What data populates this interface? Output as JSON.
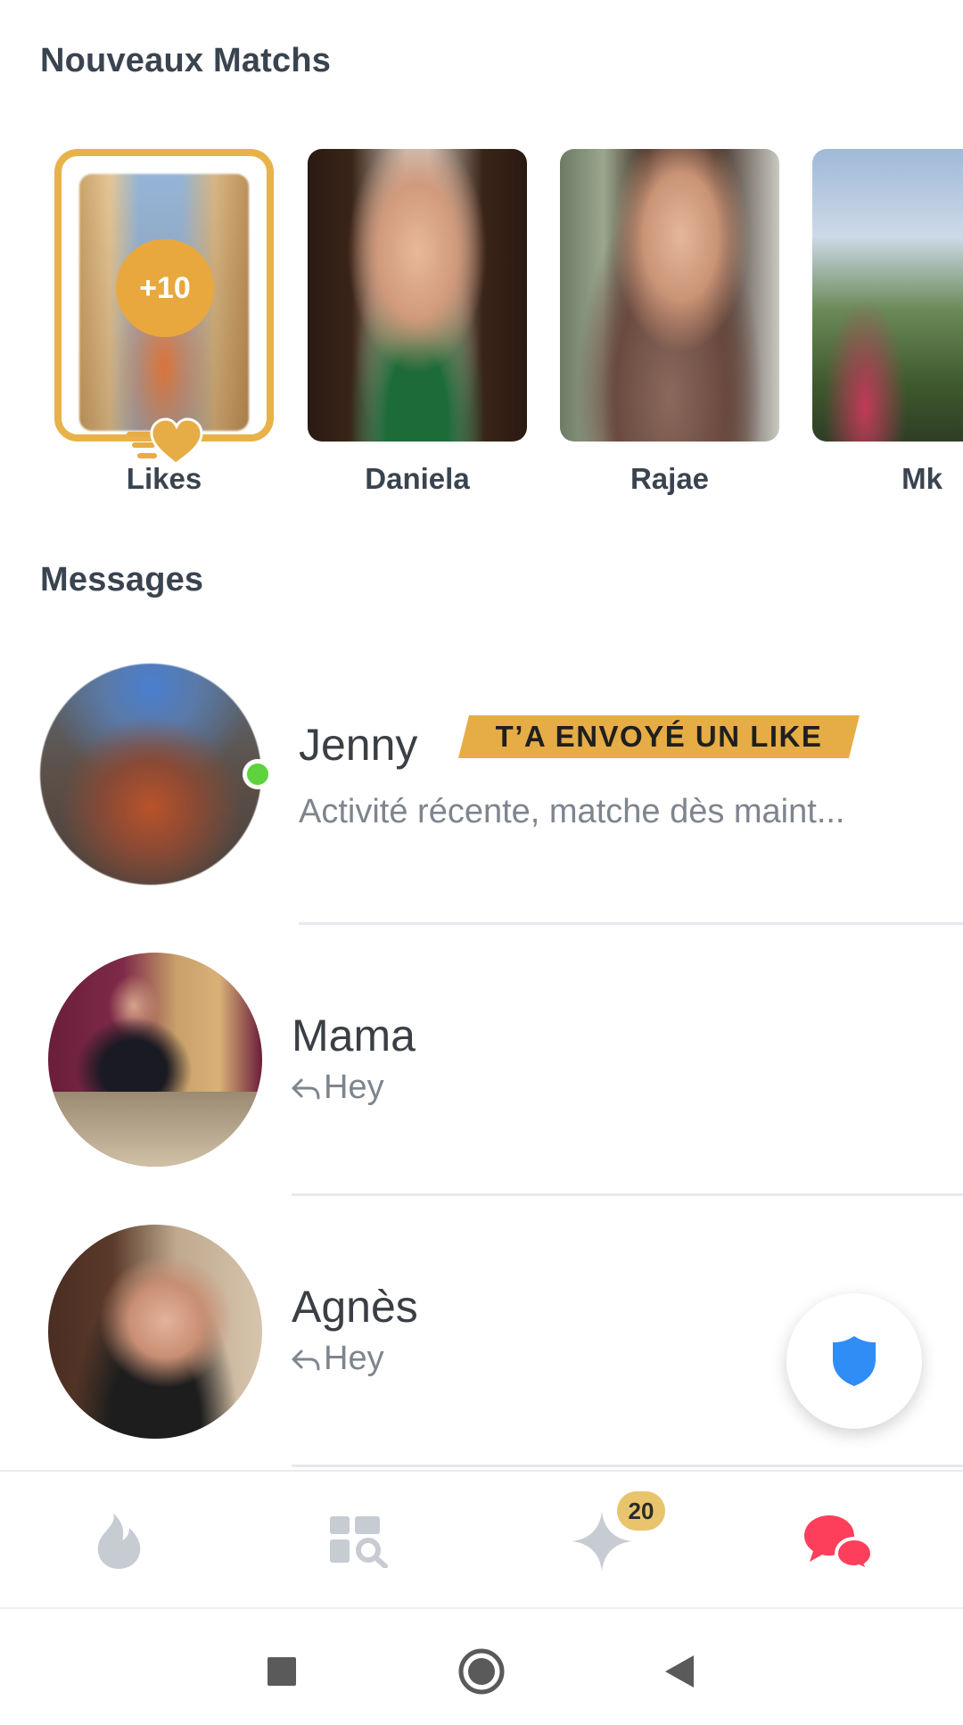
{
  "new_matches": {
    "title": "Nouveaux Matchs",
    "likes": {
      "count_label": "+10",
      "label": "Likes"
    },
    "matches": [
      {
        "name": "Daniela"
      },
      {
        "name": "Rajae"
      },
      {
        "name": "Mk"
      }
    ]
  },
  "messages": {
    "title": "Messages",
    "items": [
      {
        "name": "Jenny",
        "badge": "T’A ENVOYÉ UN LIKE",
        "preview": "Activité récente, matche dès maint...",
        "online": true
      },
      {
        "name": "Mama",
        "preview": "Hey",
        "replied": true
      },
      {
        "name": "Agnès",
        "preview": "Hey",
        "replied": true
      }
    ]
  },
  "safety_button": {
    "icon": "shield-icon"
  },
  "tabbar": {
    "tabs": [
      {
        "icon": "flame-icon"
      },
      {
        "icon": "explore-icon"
      },
      {
        "icon": "sparkle-icon",
        "badge": "20"
      },
      {
        "icon": "chat-icon",
        "active": true
      }
    ]
  },
  "system_nav": {
    "buttons": [
      "recents-icon",
      "home-icon",
      "back-icon"
    ]
  },
  "colors": {
    "gold": "#e6ac46",
    "online": "#5fd33e",
    "chat_active": "#fd3f5b",
    "shield": "#2f8df5"
  }
}
